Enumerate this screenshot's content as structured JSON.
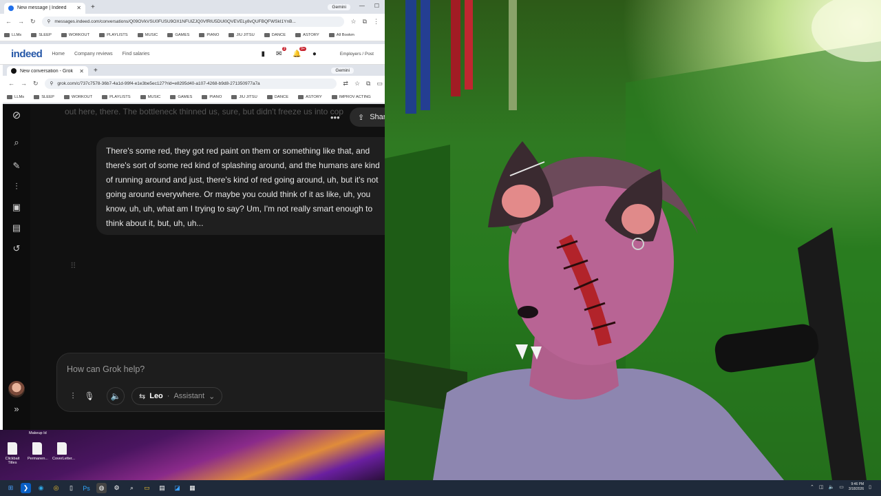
{
  "browser_back": {
    "tab_title": "New message | Indeed",
    "gemini_chip": "Gemini",
    "url": "messages.indeed.com/conversations/Q09OVkVSU0FUSU9OX1NFUlZJQ0VfRlU5DUl0QVEVELy8vQUFBQFWSkI1YnB...",
    "bookmarks": [
      "LLMs",
      "SLEEP",
      "WORKOUT",
      "PLAYLISTS",
      "MUSIC",
      "GAMES",
      "PIANO",
      "JIU JITSU",
      "DANCE",
      "ASTORY"
    ],
    "all_bookmarks": "All Bookm"
  },
  "indeed": {
    "logo": "indeed",
    "links": [
      "Home",
      "Company reviews",
      "Find salaries"
    ],
    "msg_badge": "3",
    "notif_badge": "9+",
    "employers": "Employers / Post"
  },
  "browser_front": {
    "tab_title": "New conversation - Grok",
    "gemini_chip": "Gemini",
    "url": "grok.com/c/737c7578-36b7-4a1d-99f4-e1e3be5ec127?rid=e8295d40-a107-4268-b9d8-271350977a7a",
    "bookmarks": [
      "LLMs",
      "SLEEP",
      "WORKOUT",
      "PLAYLISTS",
      "MUSIC",
      "GAMES",
      "PIANO",
      "JIU JITSU",
      "DANCE",
      "ASTORY",
      "IMPROV ACTING"
    ]
  },
  "grok": {
    "faded_text": "out here, there. The bottleneck thinned us, sure, but didn't freeze us into cop",
    "share_label": "Shar",
    "user_message": "There's some red, they got red paint on them or something like that, and there's sort of some red kind of splashing around, and the humans are kind of running around and just, there's kind of red going around, uh, but it's not going around everywhere. Or maybe you could think of it as like, uh, you know, uh, uh, what am I trying to say? Um, I'm not really smart enough to think about it, but, uh, uh...",
    "composer_placeholder": "How can Grok help?",
    "model_name": "Leo",
    "model_mode": "Assistant"
  },
  "desktop": {
    "top_label": "Makeup Id",
    "icons": [
      "Clickbait Titles",
      "Permanen...",
      "CoverLetter..."
    ]
  },
  "taskbar": {
    "time": "9:46 PM",
    "date": "3/18/2026"
  }
}
